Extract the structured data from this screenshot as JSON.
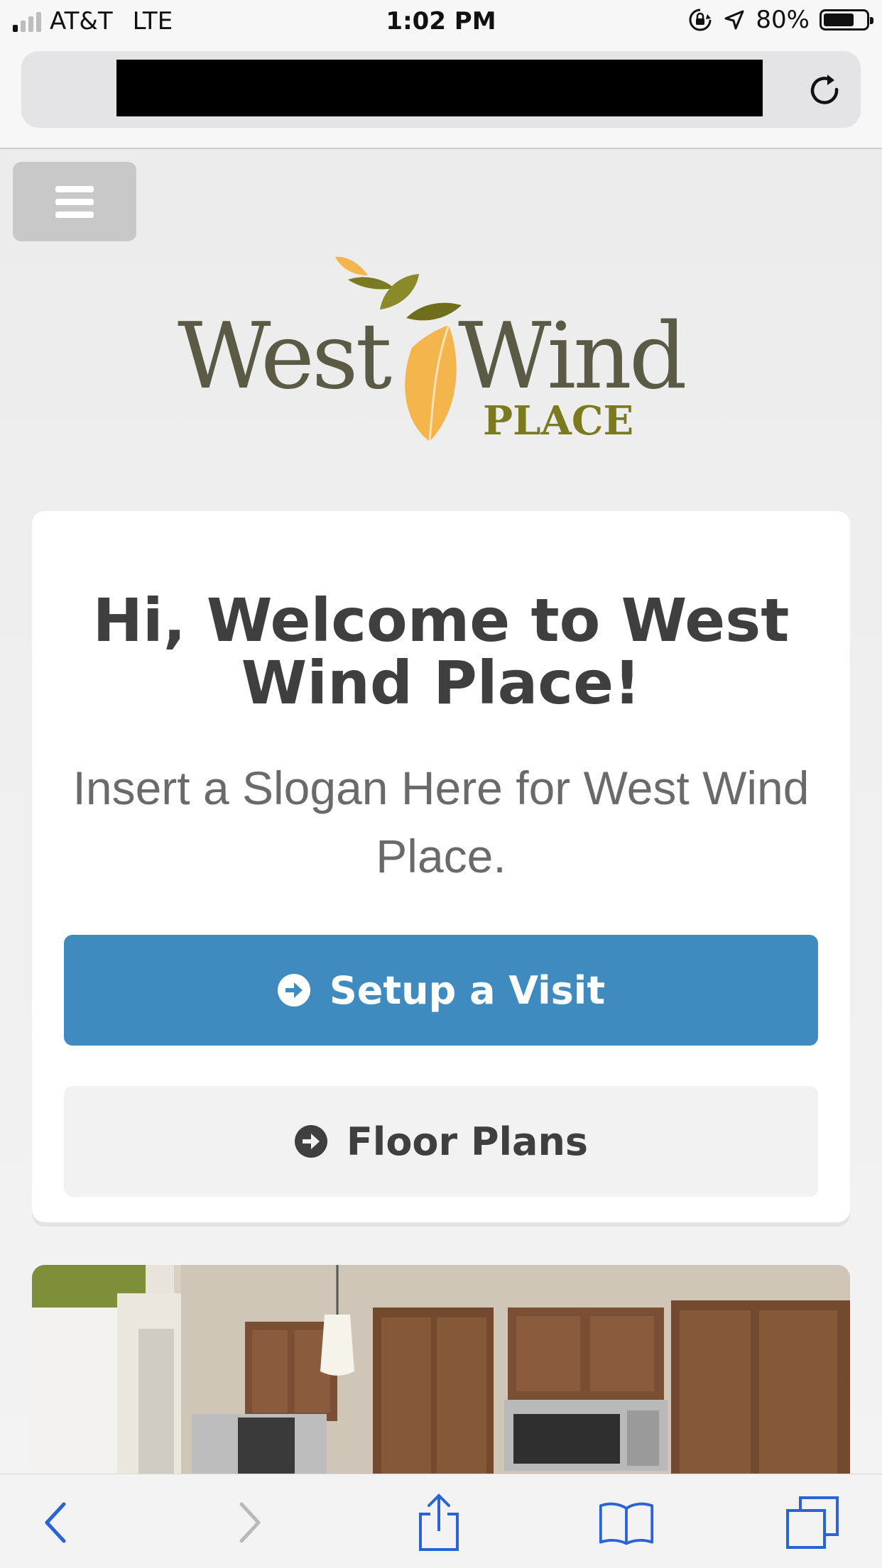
{
  "status_bar": {
    "carrier": "AT&T",
    "network": "LTE",
    "time": "1:02 PM",
    "battery_percent": "80%",
    "battery_level": 0.8,
    "signal_bars_on": 1,
    "signal_bars_total": 4,
    "icons": [
      "orientation-lock-icon",
      "location-arrow-icon",
      "battery-icon"
    ]
  },
  "browser": {
    "url": "",
    "url_redacted": true,
    "reload_icon": "reload-icon"
  },
  "site": {
    "menu_icon": "hamburger-menu-icon",
    "logo_text_main": "West Wind",
    "logo_text_sub": "PLACE",
    "colors": {
      "logo_text": "#5b5a45",
      "logo_sub": "#7c7a1e",
      "leaf_olive": "#7a7a22",
      "leaf_orange": "#f3b54c",
      "primary_button": "#3f8bc0",
      "secondary_button": "#f2f2f2",
      "heading": "#3f3f3f"
    }
  },
  "card": {
    "title": "Hi, Welcome to West Wind Place!",
    "slogan": "Insert a Slogan Here for West Wind Place.",
    "buttons": [
      {
        "label": "Setup a Visit",
        "icon": "arrow-circle-right-icon"
      },
      {
        "label": "Floor Plans",
        "icon": "arrow-circle-right-icon"
      }
    ]
  },
  "photo": {
    "subject": "kitchen-photo"
  },
  "toolbar": {
    "items": [
      "back-icon",
      "forward-icon",
      "share-icon",
      "bookmarks-icon",
      "tabs-icon"
    ],
    "forward_enabled": false
  }
}
